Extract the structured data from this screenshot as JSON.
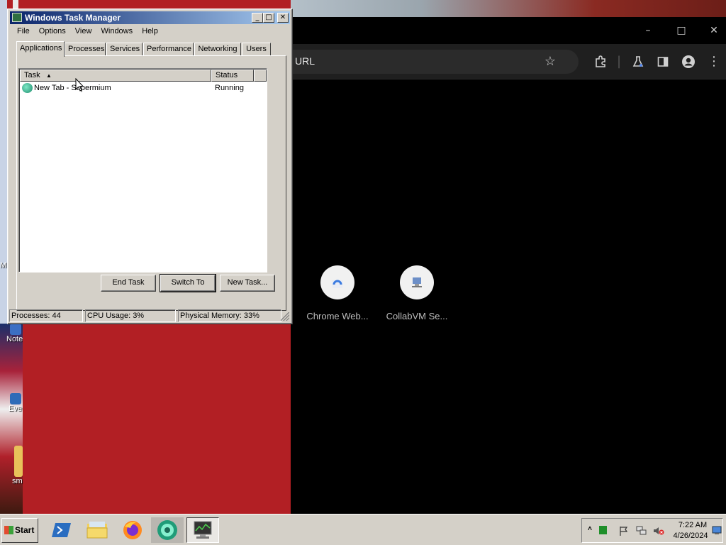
{
  "taskmgr": {
    "title": "Windows Task Manager",
    "menu": [
      "File",
      "Options",
      "View",
      "Windows",
      "Help"
    ],
    "tabs": [
      "Applications",
      "Processes",
      "Services",
      "Performance",
      "Networking",
      "Users"
    ],
    "active_tab": "Applications",
    "columns": [
      "Task",
      "Status"
    ],
    "rows": [
      {
        "task": "New Tab - Supermium",
        "status": "Running"
      }
    ],
    "buttons": {
      "end_task": "End Task",
      "switch_to": "Switch To",
      "new_task": "New Task..."
    },
    "status": {
      "processes": "Processes: 44",
      "cpu": "CPU Usage: 3%",
      "memory": "Physical Memory: 33%"
    }
  },
  "browser": {
    "omnibox_text": "URL",
    "shortcuts": [
      {
        "label": "Chrome Web...",
        "icon": "chrome-web-store-icon"
      },
      {
        "label": "CollabVM Se...",
        "icon": "collabvm-icon"
      }
    ]
  },
  "desktop": {
    "icons": [
      "M",
      "Note",
      "Eve",
      "sm"
    ]
  },
  "taskbar": {
    "start_label": "Start",
    "clock_time": "7:22 AM",
    "clock_date": "4/26/2024",
    "quick_launch": [
      "powershell-icon",
      "explorer-icon",
      "firefox-icon",
      "supermium-icon",
      "task-manager-icon"
    ]
  },
  "colors": {
    "titlebar_start": "#0a246a",
    "titlebar_end": "#a6caf0",
    "window_face": "#d4d0c8",
    "browser_bg": "#000000",
    "browser_toolbar": "#1f1f1f"
  }
}
